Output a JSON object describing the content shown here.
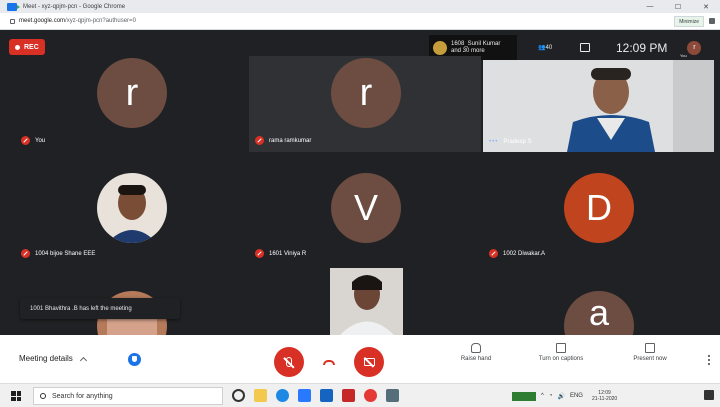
{
  "window": {
    "title": "Meet - xyz-qpjm-pcn - Google Chrome",
    "controls": [
      "—",
      "☐",
      "✕"
    ]
  },
  "address_bar": {
    "domain": "meet.google.com",
    "path": "/xyz-qpjm-pcn?authuser=0",
    "minimize_chip": "Minimize"
  },
  "meeting": {
    "rec_label": "REC",
    "top_info": {
      "line1": "1608_Sunil Kumar",
      "line2": "and 30 more"
    },
    "people_count": "40",
    "clock": "12:09 PM",
    "you_avatar_letter": "r",
    "you_label": "You",
    "tiles": [
      {
        "name": "You",
        "letter": "r",
        "avatar_color": "#6d4c41"
      },
      {
        "name": "rama ramkumar",
        "letter": "r",
        "avatar_color": "#6d4c41"
      },
      {
        "name": "Pradeep S",
        "type": "video"
      },
      {
        "name": "1004 bijoe Shane EEE",
        "type": "photo"
      },
      {
        "name": "1601 Viniya R",
        "letter": "V",
        "avatar_color": "#6d4c41"
      },
      {
        "name": "1002 Diwakar.A",
        "letter": "D",
        "avatar_color": "#c0441e"
      },
      {
        "name": "",
        "type": "photo"
      },
      {
        "name": "",
        "type": "video"
      },
      {
        "name": "",
        "letter": "a",
        "avatar_color": "#6d4c41"
      }
    ],
    "toast": "1001 Bhavithra .B has left the meeting"
  },
  "controls": {
    "meeting_details": "Meeting details",
    "raise_hand": "Raise hand",
    "captions": "Turn on captions",
    "present": "Present now"
  },
  "taskbar": {
    "search_placeholder": "Search for anything",
    "lang": "ENG",
    "time": "12:09",
    "date": "21-11-2020"
  }
}
